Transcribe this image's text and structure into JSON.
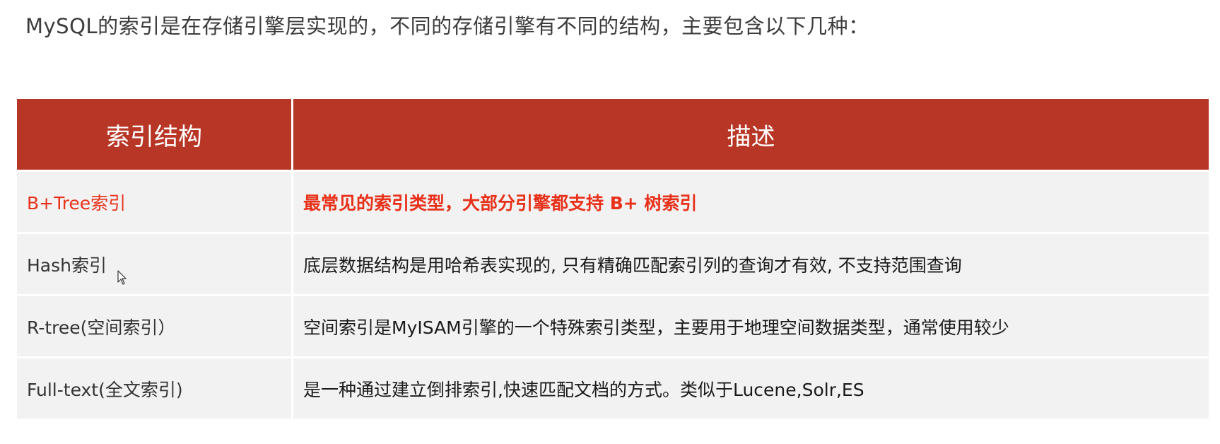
{
  "intro": "MySQL的索引是在存储引擎层实现的，不同的存储引擎有不同的结构，主要包含以下几种：",
  "table": {
    "headers": [
      "索引结构",
      "描述"
    ],
    "rows": [
      {
        "structure": "B+Tree索引",
        "description": "最常见的索引类型，大部分引擎都支持 B+ 树索引"
      },
      {
        "structure": "Hash索引",
        "description": "底层数据结构是用哈希表实现的, 只有精确匹配索引列的查询才有效, 不支持范围查询"
      },
      {
        "structure": "R-tree(空间索引）",
        "description": "空间索引是MyISAM引擎的一个特殊索引类型，主要用于地理空间数据类型，通常使用较少"
      },
      {
        "structure": "Full-text(全文索引)",
        "description": "是一种通过建立倒排索引,快速匹配文档的方式。类似于Lucene,Solr,ES"
      }
    ]
  },
  "colors": {
    "header_bg": "#b83625",
    "highlight_text": "#e8311a",
    "row_bg": "#f2f2f2"
  }
}
